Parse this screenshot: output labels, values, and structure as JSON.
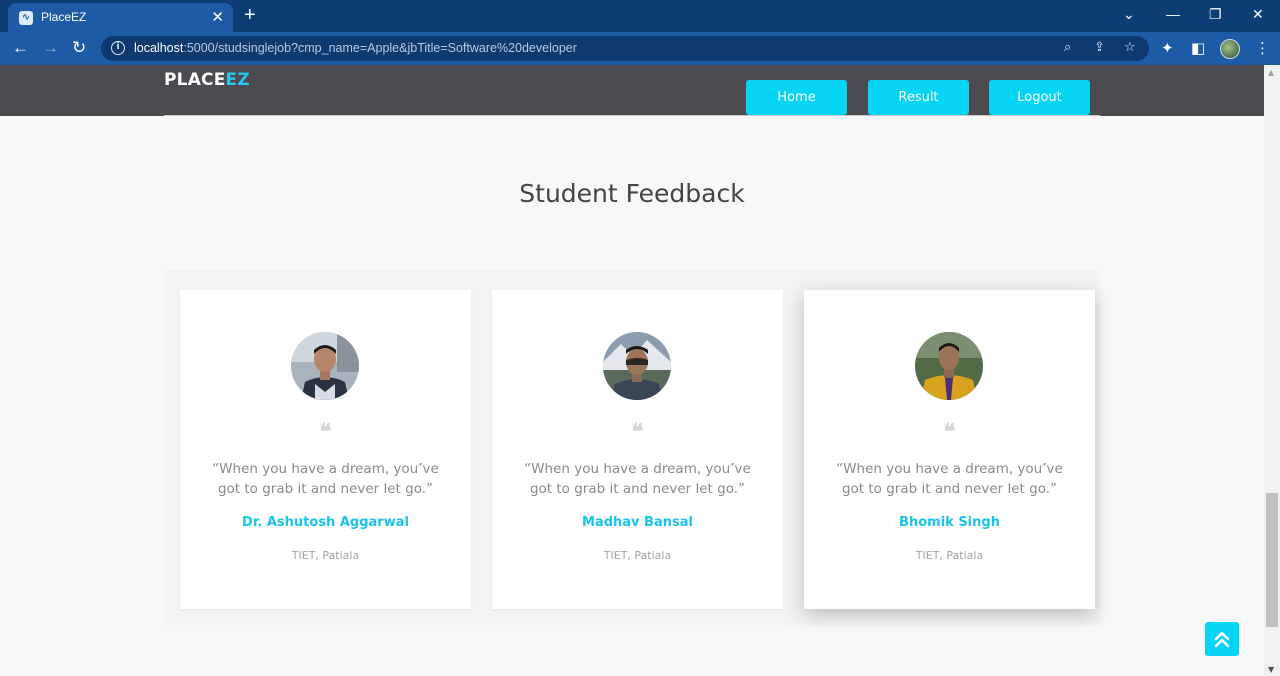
{
  "browser": {
    "tab_title": "PlaceEZ",
    "tab_close": "✕",
    "new_tab": "+",
    "url_host": "localhost",
    "url_rest": ":5000/studsinglejob?cmp_name=Apple&jbTitle=Software%20developer"
  },
  "header": {
    "logo_main": "PLACE",
    "logo_accent": "EZ",
    "nav": {
      "home": "Home",
      "result": "Result",
      "logout": "Logout"
    }
  },
  "section": {
    "title": "Student Feedback"
  },
  "testimonials": [
    {
      "quote": "“When you have a dream, you’ve got to grab it and never let go.”",
      "name": "Dr. Ashutosh Aggarwal",
      "org": "TIET, Patiala"
    },
    {
      "quote": "“When you have a dream, you’ve got to grab it and never let go.”",
      "name": "Madhav Bansal",
      "org": "TIET, Patiala"
    },
    {
      "quote": "“When you have a dream, you’ve got to grab it and never let go.”",
      "name": "Bhomik Singh",
      "org": "TIET, Patiala"
    }
  ],
  "colors": {
    "accent": "#05d4f5",
    "name_color": "#19c3ec",
    "header_bg": "#4b4b50"
  },
  "icons": {
    "quote": "quote-icon",
    "scroll_top": "double-chevron-up-icon"
  }
}
